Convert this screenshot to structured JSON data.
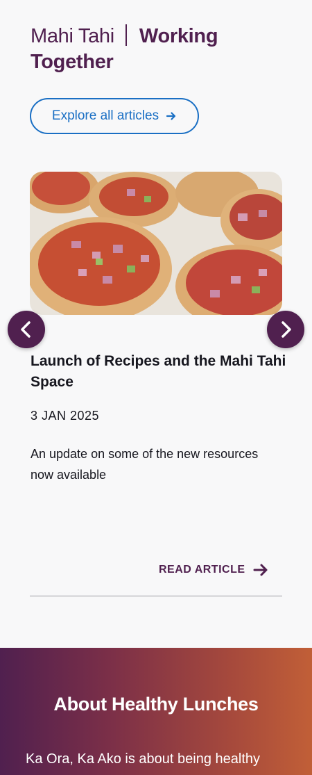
{
  "header": {
    "title_light": "Mahi Tahi",
    "title_bold": "Working Together"
  },
  "explore_button": {
    "label": "Explore all articles",
    "icon": "arrow-right-icon"
  },
  "carousel": {
    "prev_icon": "chevron-left-icon",
    "next_icon": "chevron-right-icon",
    "article": {
      "image": "pizza-photo",
      "title": "Launch of Recipes and the Mahi Tahi Space",
      "date": "3 JAN 2025",
      "description": "An update on some of the new resources now available",
      "read_label": "READ ARTICLE"
    }
  },
  "about": {
    "heading": "About Healthy Lunches",
    "body": "Ka Ora, Ka Ako is about being healthy"
  },
  "colors": {
    "brand_purple": "#50204f",
    "link_blue": "#1a6fc4",
    "gradient_end": "#c15f37"
  }
}
